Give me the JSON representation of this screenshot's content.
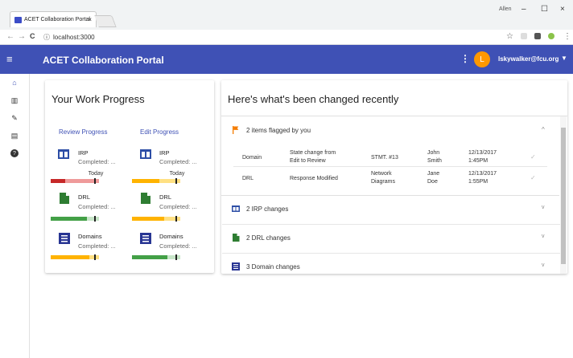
{
  "browser": {
    "tab_title": "ACET Collaboration Portal",
    "tab_close": "×",
    "url": "localhost:3000",
    "info_icon": "ⓘ",
    "star": "☆",
    "back": "←",
    "forward": "→",
    "reload": "C",
    "user_label": "Allen",
    "minimize": "–",
    "maximize": "☐",
    "close": "×"
  },
  "app": {
    "menu_icon": "≡",
    "title": "ACET Collaboration Portal",
    "kebab": "⋮",
    "avatar_letter": "L",
    "user_email": "lskywalker@fcu.org",
    "user_arrow": "▼",
    "accent": "#3f51b5"
  },
  "sidebar": {
    "icons": [
      "home-icon",
      "columns-icon",
      "edit-icon",
      "list-icon",
      "help-icon"
    ],
    "glyphs": [
      "⌂",
      "▥",
      "✎",
      "▤",
      "?"
    ]
  },
  "progress": {
    "title": "Your Work Progress",
    "review_label": "Review Progress",
    "edit_label": "Edit Progress",
    "items": [
      {
        "name": "IRP",
        "sub": "Completed: ...",
        "today": "Today"
      },
      {
        "name": "DRL",
        "sub": "Completed: ..."
      },
      {
        "name": "Domains",
        "sub": "Completed: ..."
      }
    ],
    "edit_items": [
      {
        "name": "IRP",
        "sub": "Completed: ...",
        "today": "Today"
      },
      {
        "name": "DRL",
        "sub": "Completed: ..."
      },
      {
        "name": "Domains",
        "sub": "Completed: ..."
      }
    ]
  },
  "changes": {
    "title": "Here's what's been changed recently",
    "sections": [
      {
        "label": "2 items flagged by you",
        "chevron": "^"
      },
      {
        "label": "2 IRP changes",
        "chevron": "v"
      },
      {
        "label": "2 DRL changes",
        "chevron": "v"
      },
      {
        "label": "3 Domain changes",
        "chevron": "v"
      }
    ],
    "rows": [
      {
        "area": "Domain",
        "change_1": "State change from",
        "change_2": "Edit to Review",
        "ref": "STMT. #13",
        "name_1": "John",
        "name_2": "Smith",
        "date": "12/13/2017",
        "time": "1:45PM",
        "check": "✓"
      },
      {
        "area": "DRL",
        "change_1": "Response Modified",
        "change_2": "",
        "ref_1": "Network",
        "ref_2": "Diagrams",
        "name_1": "Jane",
        "name_2": "Doe",
        "date": "12/13/2017",
        "time": "1:55PM",
        "check": "✓"
      }
    ]
  }
}
